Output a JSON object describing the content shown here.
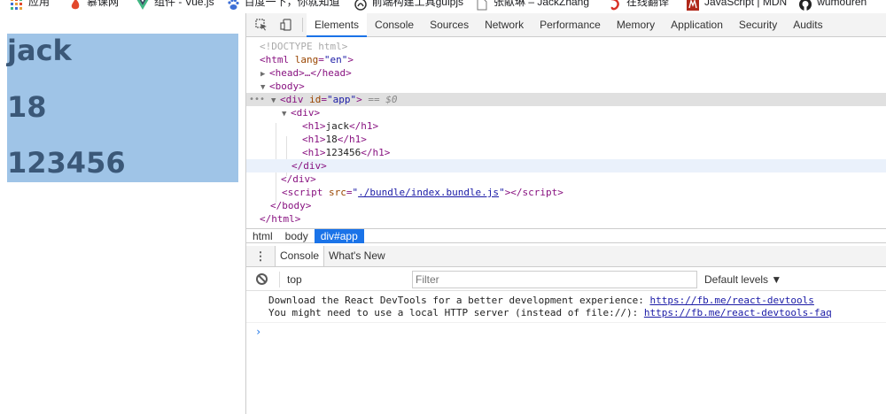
{
  "bookmarks": [
    {
      "label": "应用",
      "icon": "apps-grid-icon",
      "color": "#e8a33d"
    },
    {
      "label": "慕课网",
      "icon": "imooc-flame-icon",
      "color": "#e2482c"
    },
    {
      "label": "组件 - Vue.js",
      "icon": "vue-logo-icon",
      "color": "#41b883"
    },
    {
      "label": "百度一下，你就知道",
      "icon": "baidu-paw-icon",
      "color": "#3d6fd6"
    },
    {
      "label": "前端构建工具gulpjs",
      "icon": "gulp-icon",
      "color": "#333333"
    },
    {
      "label": "张献琳 – JackZhang",
      "icon": "page-icon",
      "color": "#777777"
    },
    {
      "label": "在线翻译",
      "icon": "translate-icon",
      "color": "#d93025"
    },
    {
      "label": "JavaScript | MDN",
      "icon": "mdn-icon",
      "color": "#b0281a"
    },
    {
      "label": "wumouren",
      "icon": "github-icon",
      "color": "#222222"
    }
  ],
  "page": {
    "headings": [
      "jack",
      "18",
      "123456"
    ],
    "highlight_color": "#9fc4e7",
    "heading_color": "#3b5878"
  },
  "devtools": {
    "tabs": [
      "Elements",
      "Console",
      "Sources",
      "Network",
      "Performance",
      "Memory",
      "Application",
      "Security",
      "Audits"
    ],
    "active_tab": "Elements",
    "elements": {
      "doctype": "<!DOCTYPE html>",
      "html_open_tag": "html",
      "html_lang_attr": "lang",
      "html_lang_val": "\"en\"",
      "head_collapsed": "<head>…</head>",
      "body_open": "<body>",
      "div_app_tag": "div",
      "div_app_attr": "id",
      "div_app_val": "\"app\"",
      "selected_marker": "== $0",
      "inner_div_open": "<div>",
      "h1_texts": [
        "jack",
        "18",
        "123456"
      ],
      "inner_div_close": "</div>",
      "app_div_close": "</div>",
      "script_attr": "src",
      "script_src": "./bundle/index.bundle.js",
      "body_close": "</body>",
      "html_close": "</html>"
    },
    "breadcrumbs": [
      "html",
      "body",
      "div#app"
    ],
    "active_breadcrumb": "div#app",
    "drawer_tabs": [
      "Console",
      "What's New"
    ],
    "console": {
      "context": "top",
      "filter_placeholder": "Filter",
      "levels": "Default levels ▼",
      "messages": [
        {
          "text": "Download the React DevTools for a better development experience: ",
          "link": "https://fb.me/react-devtools"
        },
        {
          "text": "You might need to use a local HTTP server (instead of file://): ",
          "link": "https://fb.me/react-devtools-faq"
        }
      ],
      "prompt": "›"
    },
    "accent_color": "#1a73e8"
  }
}
